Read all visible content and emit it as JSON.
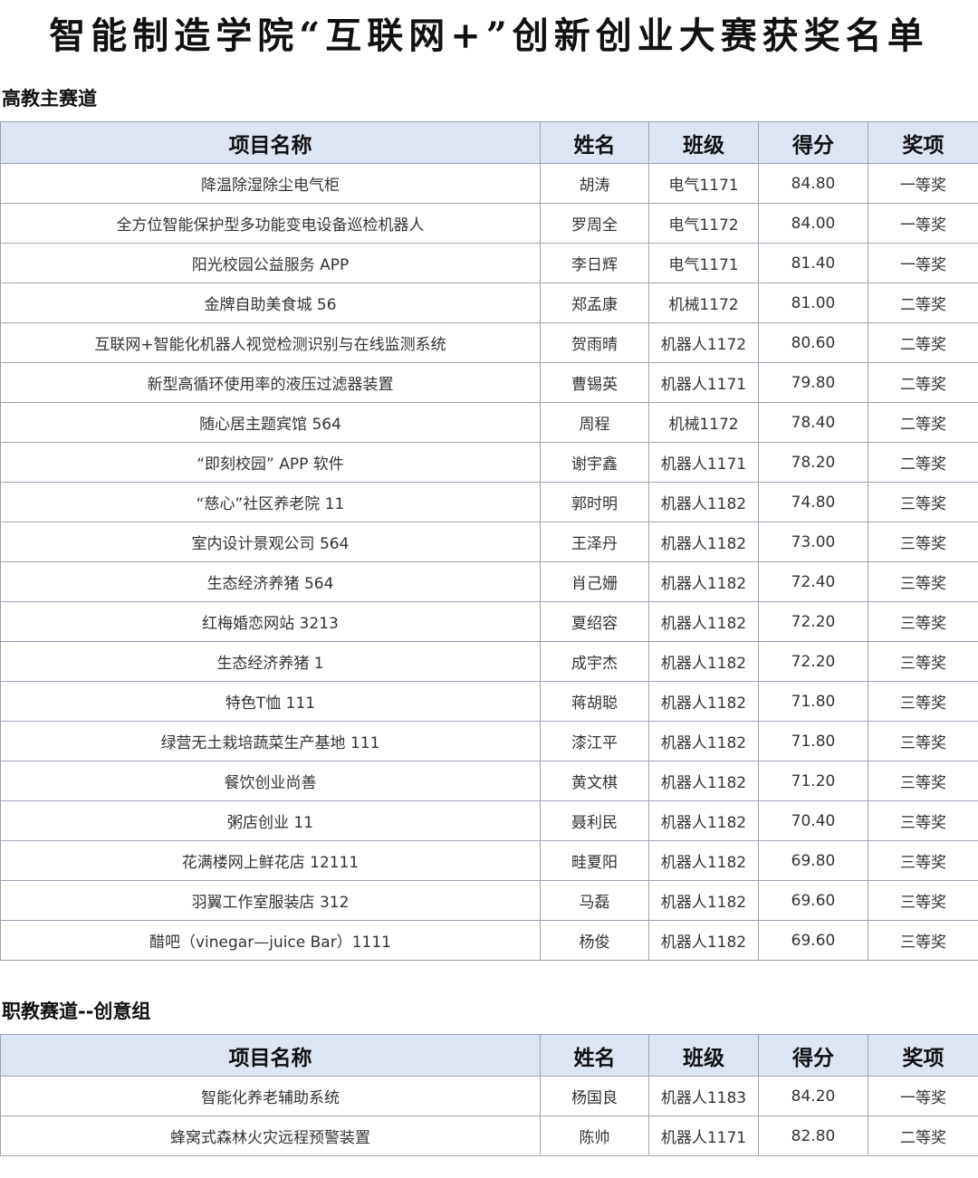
{
  "title": "智能制造学院“互联网+”创新创业大赛获奖名单",
  "columns": {
    "project": "项目名称",
    "name": "姓名",
    "class": "班级",
    "score": "得分",
    "award": "奖项"
  },
  "section1": {
    "label": "高教主赛道",
    "rows": [
      {
        "project": "降温除湿除尘电气柜",
        "name": "胡涛",
        "class": "电气1171",
        "score": "84.80",
        "award": "一等奖"
      },
      {
        "project": "全方位智能保护型多功能变电设备巡检机器人",
        "name": "罗周全",
        "class": "电气1172",
        "score": "84.00",
        "award": "一等奖"
      },
      {
        "project": "阳光校园公益服务 APP",
        "name": "李日辉",
        "class": "电气1171",
        "score": "81.40",
        "award": "一等奖"
      },
      {
        "project": "金牌自助美食城 56",
        "name": "郑孟康",
        "class": "机械1172",
        "score": "81.00",
        "award": "二等奖"
      },
      {
        "project": "互联网+智能化机器人视觉检测识别与在线监测系统",
        "name": "贺雨晴",
        "class": "机器人1172",
        "score": "80.60",
        "award": "二等奖"
      },
      {
        "project": "新型高循环使用率的液压过滤器装置",
        "name": "曹锡英",
        "class": "机器人1171",
        "score": "79.80",
        "award": "二等奖"
      },
      {
        "project": "随心居主题宾馆 564",
        "name": "周程",
        "class": "机械1172",
        "score": "78.40",
        "award": "二等奖"
      },
      {
        "project": "“即刻校园” APP 软件",
        "name": "谢宇鑫",
        "class": "机器人1171",
        "score": "78.20",
        "award": "二等奖"
      },
      {
        "project": "“慈心”社区养老院 11",
        "name": "郭时明",
        "class": "机器人1182",
        "score": "74.80",
        "award": "三等奖"
      },
      {
        "project": "室内设计景观公司 564",
        "name": "王泽丹",
        "class": "机器人1182",
        "score": "73.00",
        "award": "三等奖"
      },
      {
        "project": "生态经济养猪 564",
        "name": "肖己姗",
        "class": "机器人1182",
        "score": "72.40",
        "award": "三等奖"
      },
      {
        "project": "红梅婚恋网站 3213",
        "name": "夏绍容",
        "class": "机器人1182",
        "score": "72.20",
        "award": "三等奖"
      },
      {
        "project": "生态经济养猪 1",
        "name": "成宇杰",
        "class": "机器人1182",
        "score": "72.20",
        "award": "三等奖"
      },
      {
        "project": "特色T恤 111",
        "name": "蒋胡聪",
        "class": "机器人1182",
        "score": "71.80",
        "award": "三等奖"
      },
      {
        "project": "绿营无土栽培蔬菜生产基地 111",
        "name": "漆江平",
        "class": "机器人1182",
        "score": "71.80",
        "award": "三等奖"
      },
      {
        "project": "餐饮创业尚善",
        "name": "黄文棋",
        "class": "机器人1182",
        "score": "71.20",
        "award": "三等奖"
      },
      {
        "project": "粥店创业 11",
        "name": "聂利民",
        "class": "机器人1182",
        "score": "70.40",
        "award": "三等奖"
      },
      {
        "project": "花满楼网上鲜花店 12111",
        "name": "畦夏阳",
        "class": "机器人1182",
        "score": "69.80",
        "award": "三等奖"
      },
      {
        "project": "羽翼工作室服装店 312",
        "name": "马磊",
        "class": "机器人1182",
        "score": "69.60",
        "award": "三等奖"
      },
      {
        "project": "醋吧（vinegar—juice Bar）1111",
        "name": "杨俊",
        "class": "机器人1182",
        "score": "69.60",
        "award": "三等奖"
      }
    ]
  },
  "section2": {
    "label": "职教赛道--创意组",
    "rows": [
      {
        "project": "智能化养老辅助系统",
        "name": "杨国良",
        "class": "机器人1183",
        "score": "84.20",
        "award": "一等奖"
      },
      {
        "project": "蜂窝式森林火灾远程预警装置",
        "name": "陈帅",
        "class": "机器人1171",
        "score": "82.80",
        "award": "二等奖"
      }
    ]
  }
}
